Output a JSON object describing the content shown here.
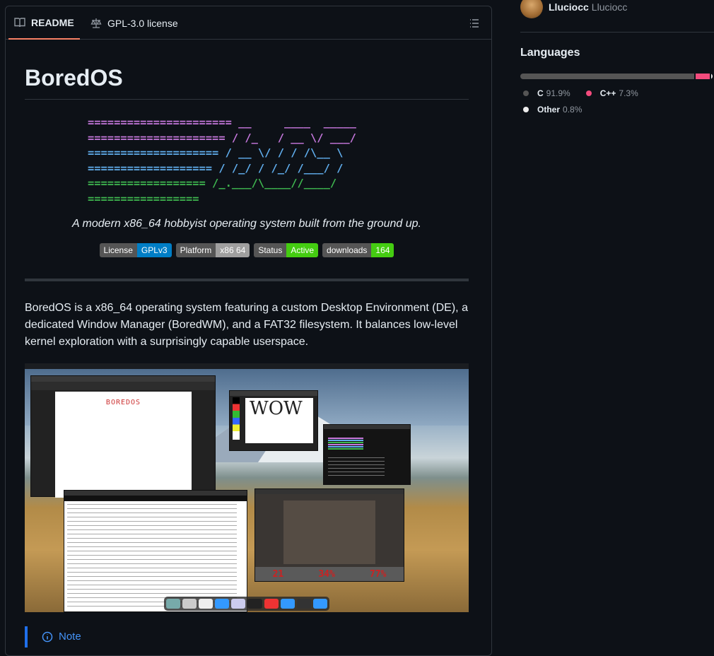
{
  "tabs": {
    "readme": "README",
    "license": "GPL-3.0 license"
  },
  "readme": {
    "title": "BoredOS",
    "ascii": [
      {
        "text": "====================== __     ____  _____",
        "color": "#c678dd"
      },
      {
        "text": "===================== / /_   / __ \\/ ___/",
        "color": "#c678dd"
      },
      {
        "text": "==================== / __ \\/ / / /\\__ \\",
        "color": "#61afef"
      },
      {
        "text": "=================== / /_/ / /_/ /___/ /",
        "color": "#61afef"
      },
      {
        "text": "================== /_.___/\\____//____/",
        "color": "#3fb950"
      },
      {
        "text": "=================",
        "color": "#3fb950"
      }
    ],
    "tagline": "A modern x86_64 hobbyist operating system built from the ground up.",
    "badges": [
      {
        "label": "License",
        "value": "GPLv3",
        "color": "#007ec6"
      },
      {
        "label": "Platform",
        "value": "x86 64",
        "color": "#9f9f9f"
      },
      {
        "label": "Status",
        "value": "Active",
        "color": "#4c1"
      },
      {
        "label": "downloads",
        "value": "164",
        "color": "#4c1"
      }
    ],
    "paragraph": "BoredOS is a x86_64 operating system featuring a custom Desktop Environment (DE), a dedicated Window Manager (BoredWM), and a FAT32 filesystem. It balances low-level kernel exploration with a surprisingly capable userspace.",
    "note_title": "Note"
  },
  "screenshot": {
    "writer_text": "BOREDOS",
    "paint_text": "WOW",
    "doom_numbers": [
      "21",
      "34%",
      "77%"
    ]
  },
  "sidebar": {
    "user_login": "Lluciocc",
    "user_name": "Lluciocc",
    "languages_heading": "Languages",
    "languages": [
      {
        "name": "C",
        "percent": "91.9%",
        "value": 91.9,
        "color": "#555555"
      },
      {
        "name": "C++",
        "percent": "7.3%",
        "value": 7.3,
        "color": "#f34b7d"
      },
      {
        "name": "Other",
        "percent": "0.8%",
        "value": 0.8,
        "color": "#ededed"
      }
    ]
  }
}
